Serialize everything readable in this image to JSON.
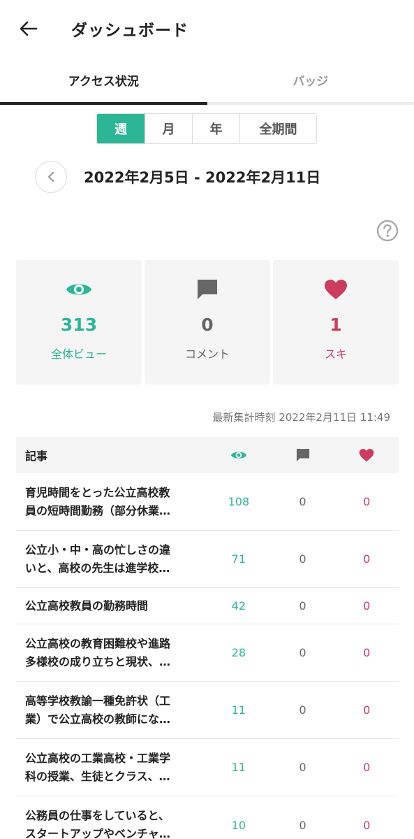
{
  "header": {
    "title": "ダッシュボード",
    "back_icon": "back-arrow-icon"
  },
  "tabs": [
    {
      "label": "アクセス状況",
      "active": true
    },
    {
      "label": "バッジ",
      "active": false
    }
  ],
  "periods": [
    {
      "label": "週",
      "selected": true
    },
    {
      "label": "月",
      "selected": false
    },
    {
      "label": "年",
      "selected": false
    },
    {
      "label": "全期間",
      "selected": false
    }
  ],
  "date_range": "2022年2月5日 - 2022年2月11日",
  "stats": {
    "views": {
      "value": "313",
      "label": "全体ビュー",
      "icon": "eye-icon",
      "color": "#2cb696"
    },
    "comments": {
      "value": "0",
      "label": "コメント",
      "icon": "comment-icon",
      "color": "#666666"
    },
    "likes": {
      "value": "1",
      "label": "スキ",
      "icon": "heart-icon",
      "color": "#cb3d5e"
    }
  },
  "updated_at": "最新集計時刻 2022年2月11日 11:49",
  "table": {
    "header_title": "記事",
    "rows": [
      {
        "title_line1": "育児時間をとった公立高校教",
        "title_line2": "員の短時間勤務（部分休業…",
        "views": "108",
        "comments": "0",
        "likes": "0"
      },
      {
        "title_line1": "公立小・中・高の忙しさの違",
        "title_line2": "いと、高校の先生は進学校…",
        "views": "71",
        "comments": "0",
        "likes": "0"
      },
      {
        "title_line1": "公立高校教員の勤務時間",
        "title_line2": "",
        "views": "42",
        "comments": "0",
        "likes": "0"
      },
      {
        "title_line1": "公立高校の教育困難校や進路",
        "title_line2": "多様校の成り立ちと現状、…",
        "views": "28",
        "comments": "0",
        "likes": "0"
      },
      {
        "title_line1": "高等学校教諭一種免許状（工",
        "title_line2": "業）で公立高校の教師にな…",
        "views": "11",
        "comments": "0",
        "likes": "0"
      },
      {
        "title_line1": "公立高校の工業高校・工業学",
        "title_line2": "科の授業、生徒とクラス、…",
        "views": "11",
        "comments": "0",
        "likes": "0"
      },
      {
        "title_line1": "公務員の仕事をしていると、",
        "title_line2": "スタートアップやベンチャ…",
        "views": "10",
        "comments": "0",
        "likes": "0"
      }
    ]
  },
  "colors": {
    "accent": "#2cb696",
    "like": "#cb3d5e",
    "neutral": "#666666"
  }
}
